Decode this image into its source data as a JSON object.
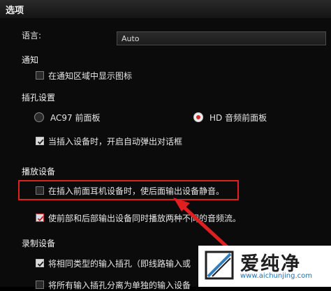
{
  "window": {
    "title": "选项"
  },
  "language": {
    "label": "语言:",
    "value": "Auto"
  },
  "notify": {
    "title": "通知",
    "show_icon": {
      "label": "在通知区域中显示图标",
      "checked": false
    }
  },
  "jack": {
    "title": "插孔设置",
    "ac97": {
      "label": "AC97 前面板",
      "selected": false
    },
    "hd": {
      "label": "HD 音频前面板",
      "selected": true
    },
    "popup": {
      "label": "当插入设备时，开启自动弹出对话框",
      "checked": true
    }
  },
  "playback": {
    "title": "播放设备",
    "mute_rear": {
      "label": "在插入前面耳机设备时，使后面输出设备静音。",
      "checked": false
    },
    "dual_stream": {
      "label": "使前部和后部输出设备同时播放两种不同的音频流。",
      "checked": true
    }
  },
  "recording": {
    "title": "录制设备",
    "tag_same": {
      "label": "将相同类型的输入插孔（即线路输入或",
      "checked": true
    },
    "split_all": {
      "label": "将所有输入插孔分离为单独的输入设备",
      "checked": false
    }
  },
  "watermark": {
    "brand": "爱纯净",
    "url": "www.aichunjing.com"
  },
  "colors": {
    "accent_red": "#e02020",
    "background": "#0b0b0b"
  }
}
